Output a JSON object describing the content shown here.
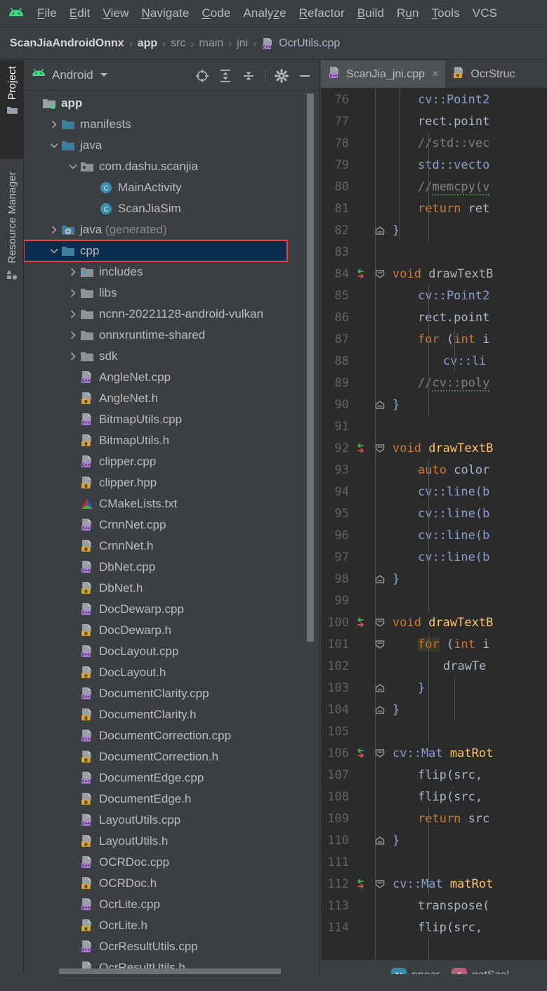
{
  "app": {
    "logo_icon": "android-logo-icon"
  },
  "menubar": {
    "items": [
      {
        "label": "File",
        "mnemonic": "F"
      },
      {
        "label": "Edit",
        "mnemonic": "E"
      },
      {
        "label": "View",
        "mnemonic": "V"
      },
      {
        "label": "Navigate",
        "mnemonic": "N"
      },
      {
        "label": "Code",
        "mnemonic": "C"
      },
      {
        "label": "Analyze",
        "mnemonic": "z"
      },
      {
        "label": "Refactor",
        "mnemonic": "R"
      },
      {
        "label": "Build",
        "mnemonic": "B"
      },
      {
        "label": "Run",
        "mnemonic": "u"
      },
      {
        "label": "Tools",
        "mnemonic": "T"
      },
      {
        "label": "VCS",
        "mnemonic": ""
      }
    ]
  },
  "breadcrumb": {
    "items": [
      {
        "label": "ScanJiaAndroidOnnx",
        "style": "bold",
        "icon": ""
      },
      {
        "label": "app",
        "style": "bold",
        "icon": ""
      },
      {
        "label": "src",
        "style": "dim",
        "icon": ""
      },
      {
        "label": "main",
        "style": "dim",
        "icon": ""
      },
      {
        "label": "jni",
        "style": "dim",
        "icon": ""
      },
      {
        "label": "OcrUtils.cpp",
        "style": "normal",
        "icon": "cpp-file-icon"
      }
    ],
    "separator": "›"
  },
  "toolstrip": {
    "tabs": [
      {
        "label": "Project",
        "icon": "folder-icon",
        "active": true
      },
      {
        "label": "Resource Manager",
        "icon": "resource-manager-icon",
        "active": false
      }
    ]
  },
  "project_panel": {
    "title": "Android",
    "title_icon": "android-head-icon",
    "dropdown_icon": "chevron-down-icon",
    "tools": [
      {
        "name": "select-opened-file-icon",
        "label": "Select Opened File"
      },
      {
        "name": "expand-all-icon",
        "label": "Expand All"
      },
      {
        "name": "collapse-all-icon",
        "label": "Collapse All"
      },
      {
        "name": "settings-gear-icon",
        "label": "Settings"
      },
      {
        "name": "hide-icon",
        "label": "Hide"
      }
    ],
    "tree": [
      {
        "label": "app",
        "indent": 0,
        "arrow": "",
        "icon": "module-folder-icon",
        "bold": true,
        "selected": false
      },
      {
        "label": "manifests",
        "indent": 1,
        "arrow": "collapsed",
        "icon": "folder-blue-icon",
        "bold": false,
        "selected": false
      },
      {
        "label": "java",
        "indent": 1,
        "arrow": "expanded",
        "icon": "folder-blue-icon",
        "bold": false,
        "selected": false
      },
      {
        "label": "com.dashu.scanjia",
        "indent": 2,
        "arrow": "expanded",
        "icon": "package-icon",
        "bold": false,
        "selected": false
      },
      {
        "label": "MainActivity",
        "indent": 3,
        "arrow": "",
        "icon": "class-icon",
        "bold": false,
        "selected": false
      },
      {
        "label": "ScanJiaSim",
        "indent": 3,
        "arrow": "",
        "icon": "class-icon",
        "bold": false,
        "selected": false
      },
      {
        "label": "java",
        "suffix": " (generated)",
        "indent": 1,
        "arrow": "collapsed",
        "icon": "folder-generated-icon",
        "bold": false,
        "selected": false
      },
      {
        "label": "cpp",
        "indent": 1,
        "arrow": "expanded",
        "icon": "folder-blue-icon",
        "bold": false,
        "selected": true
      },
      {
        "label": "includes",
        "indent": 2,
        "arrow": "collapsed",
        "icon": "includes-folder-icon",
        "bold": false,
        "selected": false
      },
      {
        "label": "libs",
        "indent": 2,
        "arrow": "collapsed",
        "icon": "folder-grey-icon",
        "bold": false,
        "selected": false
      },
      {
        "label": "ncnn-20221128-android-vulkan",
        "indent": 2,
        "arrow": "collapsed",
        "icon": "folder-grey-icon",
        "bold": false,
        "selected": false
      },
      {
        "label": "onnxruntime-shared",
        "indent": 2,
        "arrow": "collapsed",
        "icon": "folder-grey-icon",
        "bold": false,
        "selected": false
      },
      {
        "label": "sdk",
        "indent": 2,
        "arrow": "collapsed",
        "icon": "folder-grey-icon",
        "bold": false,
        "selected": false
      },
      {
        "label": "AngleNet.cpp",
        "indent": 2,
        "arrow": "",
        "icon": "cpp-file-icon",
        "bold": false,
        "selected": false
      },
      {
        "label": "AngleNet.h",
        "indent": 2,
        "arrow": "",
        "icon": "h-file-icon",
        "bold": false,
        "selected": false
      },
      {
        "label": "BitmapUtils.cpp",
        "indent": 2,
        "arrow": "",
        "icon": "cpp-file-icon",
        "bold": false,
        "selected": false
      },
      {
        "label": "BitmapUtils.h",
        "indent": 2,
        "arrow": "",
        "icon": "h-file-icon",
        "bold": false,
        "selected": false
      },
      {
        "label": "clipper.cpp",
        "indent": 2,
        "arrow": "",
        "icon": "cpp-file-icon",
        "bold": false,
        "selected": false
      },
      {
        "label": "clipper.hpp",
        "indent": 2,
        "arrow": "",
        "icon": "h-file-icon",
        "bold": false,
        "selected": false
      },
      {
        "label": "CMakeLists.txt",
        "indent": 2,
        "arrow": "",
        "icon": "cmake-file-icon",
        "bold": false,
        "selected": false
      },
      {
        "label": "CrnnNet.cpp",
        "indent": 2,
        "arrow": "",
        "icon": "cpp-file-icon",
        "bold": false,
        "selected": false
      },
      {
        "label": "CrnnNet.h",
        "indent": 2,
        "arrow": "",
        "icon": "h-file-icon",
        "bold": false,
        "selected": false
      },
      {
        "label": "DbNet.cpp",
        "indent": 2,
        "arrow": "",
        "icon": "cpp-file-icon",
        "bold": false,
        "selected": false
      },
      {
        "label": "DbNet.h",
        "indent": 2,
        "arrow": "",
        "icon": "h-file-icon",
        "bold": false,
        "selected": false
      },
      {
        "label": "DocDewarp.cpp",
        "indent": 2,
        "arrow": "",
        "icon": "cpp-file-icon",
        "bold": false,
        "selected": false
      },
      {
        "label": "DocDewarp.h",
        "indent": 2,
        "arrow": "",
        "icon": "h-file-icon",
        "bold": false,
        "selected": false
      },
      {
        "label": "DocLayout.cpp",
        "indent": 2,
        "arrow": "",
        "icon": "cpp-file-icon",
        "bold": false,
        "selected": false
      },
      {
        "label": "DocLayout.h",
        "indent": 2,
        "arrow": "",
        "icon": "h-file-icon",
        "bold": false,
        "selected": false
      },
      {
        "label": "DocumentClarity.cpp",
        "indent": 2,
        "arrow": "",
        "icon": "cpp-file-icon",
        "bold": false,
        "selected": false
      },
      {
        "label": "DocumentClarity.h",
        "indent": 2,
        "arrow": "",
        "icon": "h-file-icon",
        "bold": false,
        "selected": false
      },
      {
        "label": "DocumentCorrection.cpp",
        "indent": 2,
        "arrow": "",
        "icon": "cpp-file-icon",
        "bold": false,
        "selected": false
      },
      {
        "label": "DocumentCorrection.h",
        "indent": 2,
        "arrow": "",
        "icon": "h-file-icon",
        "bold": false,
        "selected": false
      },
      {
        "label": "DocumentEdge.cpp",
        "indent": 2,
        "arrow": "",
        "icon": "cpp-file-icon",
        "bold": false,
        "selected": false
      },
      {
        "label": "DocumentEdge.h",
        "indent": 2,
        "arrow": "",
        "icon": "h-file-icon",
        "bold": false,
        "selected": false
      },
      {
        "label": "LayoutUtils.cpp",
        "indent": 2,
        "arrow": "",
        "icon": "cpp-file-icon",
        "bold": false,
        "selected": false
      },
      {
        "label": "LayoutUtils.h",
        "indent": 2,
        "arrow": "",
        "icon": "h-file-icon",
        "bold": false,
        "selected": false
      },
      {
        "label": "OCRDoc.cpp",
        "indent": 2,
        "arrow": "",
        "icon": "cpp-file-icon",
        "bold": false,
        "selected": false
      },
      {
        "label": "OCRDoc.h",
        "indent": 2,
        "arrow": "",
        "icon": "h-file-icon",
        "bold": false,
        "selected": false
      },
      {
        "label": "OcrLite.cpp",
        "indent": 2,
        "arrow": "",
        "icon": "cpp-file-icon",
        "bold": false,
        "selected": false
      },
      {
        "label": "OcrLite.h",
        "indent": 2,
        "arrow": "",
        "icon": "h-file-icon",
        "bold": false,
        "selected": false
      },
      {
        "label": "OcrResultUtils.cpp",
        "indent": 2,
        "arrow": "",
        "icon": "cpp-file-icon",
        "bold": false,
        "selected": false
      },
      {
        "label": "OcrResultUtils.h",
        "indent": 2,
        "arrow": "",
        "icon": "h-file-icon",
        "bold": false,
        "selected": false
      }
    ]
  },
  "editor": {
    "tabs": [
      {
        "label": "ScanJia_jni.cpp",
        "icon": "cpp-file-icon",
        "active": true,
        "closable": true
      },
      {
        "label": "OcrStruc",
        "icon": "h-file-icon",
        "active": false,
        "closable": false
      }
    ],
    "close_glyph": "×",
    "lines": [
      {
        "num": "76",
        "vcs": "",
        "fold": "",
        "indent": 1,
        "text": "cv::Point2",
        "kind": "type"
      },
      {
        "num": "77",
        "vcs": "",
        "fold": "",
        "indent": 1,
        "text": "rect.point",
        "kind": "plain"
      },
      {
        "num": "78",
        "vcs": "",
        "fold": "",
        "indent": 1,
        "text": "//std::vec",
        "kind": "comment"
      },
      {
        "num": "79",
        "vcs": "",
        "fold": "",
        "indent": 1,
        "text": "std::vecto",
        "kind": "type"
      },
      {
        "num": "80",
        "vcs": "",
        "fold": "",
        "indent": 1,
        "text": "//memcpy(v",
        "kind": "comment-squiggle"
      },
      {
        "num": "81",
        "vcs": "",
        "fold": "",
        "indent": 1,
        "text": "return ret",
        "kind": "keyword-return"
      },
      {
        "num": "82",
        "vcs": "",
        "fold": "end",
        "indent": 0,
        "text": "}",
        "kind": "brace"
      },
      {
        "num": "83",
        "vcs": "",
        "fold": "",
        "indent": 0,
        "text": "",
        "kind": "plain"
      },
      {
        "num": "84",
        "vcs": "changed",
        "fold": "start",
        "indent": 0,
        "text": "void drawTextB",
        "kind": "decl-void"
      },
      {
        "num": "85",
        "vcs": "",
        "fold": "",
        "indent": 1,
        "text": "cv::Point2",
        "kind": "type"
      },
      {
        "num": "86",
        "vcs": "",
        "fold": "",
        "indent": 1,
        "text": "rect.point",
        "kind": "plain"
      },
      {
        "num": "87",
        "vcs": "",
        "fold": "",
        "indent": 1,
        "text": "for (int i",
        "kind": "for-int"
      },
      {
        "num": "88",
        "vcs": "",
        "fold": "",
        "indent": 2,
        "text": "cv::li",
        "kind": "type"
      },
      {
        "num": "89",
        "vcs": "",
        "fold": "",
        "indent": 1,
        "text": "//cv::poly",
        "kind": "comment-squiggle"
      },
      {
        "num": "90",
        "vcs": "",
        "fold": "end",
        "indent": 0,
        "text": "}",
        "kind": "brace"
      },
      {
        "num": "91",
        "vcs": "",
        "fold": "",
        "indent": 0,
        "text": "",
        "kind": "plain"
      },
      {
        "num": "92",
        "vcs": "changed",
        "fold": "start",
        "indent": 0,
        "text": "void drawTextB",
        "kind": "decl-void-fn"
      },
      {
        "num": "93",
        "vcs": "",
        "fold": "",
        "indent": 1,
        "text": "auto color",
        "kind": "auto-decl"
      },
      {
        "num": "94",
        "vcs": "",
        "fold": "",
        "indent": 1,
        "text": "cv::line(b",
        "kind": "type"
      },
      {
        "num": "95",
        "vcs": "",
        "fold": "",
        "indent": 1,
        "text": "cv::line(b",
        "kind": "type"
      },
      {
        "num": "96",
        "vcs": "",
        "fold": "",
        "indent": 1,
        "text": "cv::line(b",
        "kind": "type"
      },
      {
        "num": "97",
        "vcs": "",
        "fold": "",
        "indent": 1,
        "text": "cv::line(b",
        "kind": "type"
      },
      {
        "num": "98",
        "vcs": "",
        "fold": "end",
        "indent": 0,
        "text": "}",
        "kind": "brace"
      },
      {
        "num": "99",
        "vcs": "",
        "fold": "",
        "indent": 0,
        "text": "",
        "kind": "plain"
      },
      {
        "num": "100",
        "vcs": "changed",
        "fold": "start",
        "indent": 0,
        "text": "void drawTextB",
        "kind": "decl-void-fn"
      },
      {
        "num": "101",
        "vcs": "",
        "fold": "start",
        "indent": 1,
        "text": "for (int i",
        "kind": "for-int-highlight"
      },
      {
        "num": "102",
        "vcs": "",
        "fold": "",
        "indent": 2,
        "text": "drawTe",
        "kind": "plain"
      },
      {
        "num": "103",
        "vcs": "",
        "fold": "end",
        "indent": 1,
        "text": "}",
        "kind": "brace"
      },
      {
        "num": "104",
        "vcs": "",
        "fold": "end",
        "indent": 0,
        "text": "}",
        "kind": "brace"
      },
      {
        "num": "105",
        "vcs": "",
        "fold": "",
        "indent": 0,
        "text": "",
        "kind": "plain"
      },
      {
        "num": "106",
        "vcs": "changed",
        "fold": "start",
        "indent": 0,
        "text": "cv::Mat matRot",
        "kind": "decl-mat"
      },
      {
        "num": "107",
        "vcs": "",
        "fold": "",
        "indent": 1,
        "text": "flip(src,",
        "kind": "plain"
      },
      {
        "num": "108",
        "vcs": "",
        "fold": "",
        "indent": 1,
        "text": "flip(src,",
        "kind": "plain"
      },
      {
        "num": "109",
        "vcs": "",
        "fold": "",
        "indent": 1,
        "text": "return src",
        "kind": "keyword-return"
      },
      {
        "num": "110",
        "vcs": "",
        "fold": "end",
        "indent": 0,
        "text": "}",
        "kind": "brace"
      },
      {
        "num": "111",
        "vcs": "",
        "fold": "",
        "indent": 0,
        "text": "",
        "kind": "plain"
      },
      {
        "num": "112",
        "vcs": "changed",
        "fold": "start",
        "indent": 0,
        "text": "cv::Mat matRot",
        "kind": "decl-mat"
      },
      {
        "num": "113",
        "vcs": "",
        "fold": "",
        "indent": 1,
        "text": "transpose(",
        "kind": "plain"
      },
      {
        "num": "114",
        "vcs": "",
        "fold": "",
        "indent": 1,
        "text": "flip(src,",
        "kind": "plain"
      }
    ],
    "footer_breadcrumb": [
      {
        "badge": "N",
        "badge_color": "#2f8fa8",
        "label": "ppocr"
      },
      {
        "badge": "f",
        "badge_color": "#b5607a",
        "label": "getScal"
      }
    ],
    "footer_separator": "›"
  },
  "colors": {
    "window_bg": "#3c3f41",
    "editor_bg": "#2b2b2b",
    "selection_bg": "#0d2d4f",
    "annotation_outline": "#e8413f",
    "keyword": "#cc7832",
    "function": "#ffc66d",
    "comment": "#808080",
    "text": "#a9b7c6",
    "line_number": "#606366"
  }
}
